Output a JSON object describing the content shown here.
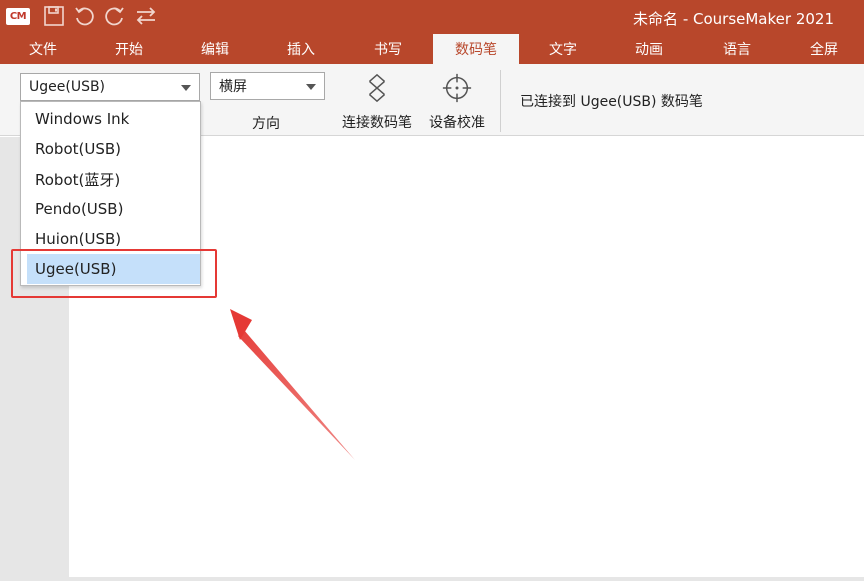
{
  "app": {
    "logo_text": "CM",
    "title": "未命名 - CourseMaker 2021",
    "brand_color": "#b8472b"
  },
  "quick_access": [
    "save-icon",
    "undo-icon",
    "redo-icon",
    "swap-icon"
  ],
  "tabs": [
    {
      "label": "文件",
      "active": false
    },
    {
      "label": "开始",
      "active": false
    },
    {
      "label": "编辑",
      "active": false
    },
    {
      "label": "插入",
      "active": false
    },
    {
      "label": "书写",
      "active": false
    },
    {
      "label": "数码笔",
      "active": true
    },
    {
      "label": "文字",
      "active": false
    },
    {
      "label": "动画",
      "active": false
    },
    {
      "label": "语言",
      "active": false
    },
    {
      "label": "全屏",
      "active": false
    }
  ],
  "ribbon": {
    "device_select": {
      "value": "Ugee(USB)"
    },
    "orientation_select": {
      "value": "横屏"
    },
    "orientation_label": "方向",
    "connect_button": {
      "label": "连接数码笔",
      "icon": "connect-pen-icon"
    },
    "calibrate_button": {
      "label": "设备校准",
      "icon": "crosshair-icon"
    },
    "status_text": "已连接到 Ugee(USB) 数码笔"
  },
  "dropdown": {
    "options": [
      {
        "label": "Windows Ink",
        "selected": false
      },
      {
        "label": "Robot(USB)",
        "selected": false
      },
      {
        "label": "Robot(蓝牙)",
        "selected": false
      },
      {
        "label": "Pendo(USB)",
        "selected": false
      },
      {
        "label": "Huion(USB)",
        "selected": false
      },
      {
        "label": "Ugee(USB)",
        "selected": true
      }
    ],
    "selected_color": "#c5e0fa"
  },
  "annotation": {
    "color": "#e53935"
  }
}
